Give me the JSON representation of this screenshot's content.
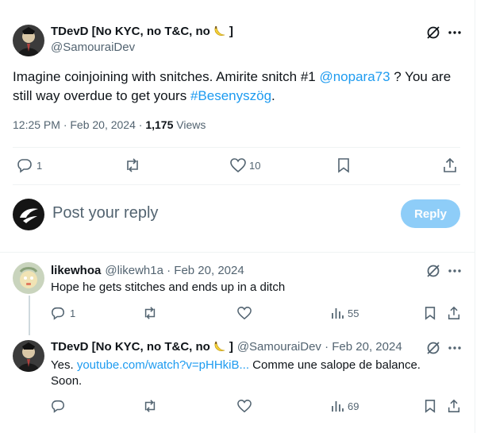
{
  "main_tweet": {
    "author_name": "TDevD [No KYC, no T&C, no",
    "author_name_end": "]",
    "author_handle": "@SamouraiDev",
    "text_before": "Imagine coinjoining with snitches. Amirite snitch #1 ",
    "mention": "@nopara73",
    "text_mid": " ? You are still way overdue to get yours ",
    "hashtag": "#Besenyszög",
    "text_end": ".",
    "time": "12:25 PM · Feb 20, 2024 · ",
    "views_count": "1,175",
    "views_label": " Views",
    "replies": "1",
    "likes": "10"
  },
  "reply_box": {
    "placeholder": "Post your reply",
    "button_label": "Reply"
  },
  "reply1": {
    "author_name": "likewhoa",
    "meta": "@likewh1a · Feb 20, 2024",
    "text": "Hope he gets stitches and ends up in a ditch",
    "replies": "1",
    "views": "55"
  },
  "reply2": {
    "author_name": "TDevD [No KYC, no T&C, no",
    "author_name_end": "]",
    "meta": "@SamouraiDev · Feb 20, 2024",
    "text_before": "Yes. ",
    "link": "youtube.com/watch?v=pHHkiB...",
    "text_after": " Comme une salope de balance. Soon.",
    "views": "69"
  },
  "colors": {
    "accent": "#1d9bf0",
    "muted": "#536471",
    "reply_button": "#8ecdf8"
  },
  "icons": [
    "grok-icon",
    "more-icon",
    "reply-icon",
    "retweet-icon",
    "like-icon",
    "bookmark-icon",
    "share-icon",
    "views-icon",
    "banana-emoji"
  ]
}
